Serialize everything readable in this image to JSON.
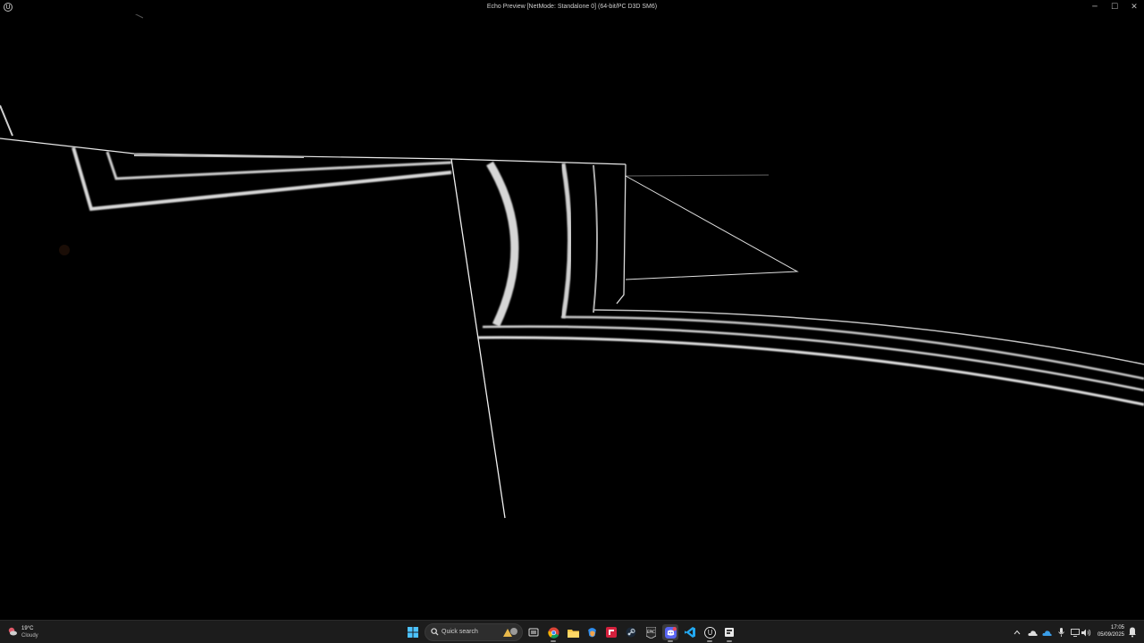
{
  "window": {
    "title": "Echo Preview [NetMode: Standalone 0]  (64-bit/PC D3D SM6)",
    "app_icon": "unreal-engine-icon",
    "controls": {
      "minimize": "─",
      "maximize": "☐",
      "close": "✕"
    }
  },
  "taskbar": {
    "weather": {
      "temperature": "19°C",
      "condition": "Cloudy",
      "icon": "cloudy-weather-icon"
    },
    "search": {
      "label": "Quick search",
      "icon": "search-icon"
    },
    "apps": [
      {
        "name": "start-button",
        "icon": "windows-logo-icon"
      },
      {
        "name": "task-view-button",
        "icon": "task-view-icon"
      },
      {
        "name": "chrome-app",
        "icon": "chrome-icon"
      },
      {
        "name": "file-explorer-app",
        "icon": "folder-icon"
      },
      {
        "name": "copilot-app",
        "icon": "copilot-icon"
      },
      {
        "name": "red-app",
        "icon": "red-app-icon"
      },
      {
        "name": "steam-app",
        "icon": "steam-icon"
      },
      {
        "name": "epic-games-app",
        "icon": "epic-games-icon"
      },
      {
        "name": "discord-app",
        "icon": "discord-icon"
      },
      {
        "name": "vscode-app",
        "icon": "vscode-icon"
      },
      {
        "name": "unreal-engine-app",
        "icon": "unreal-engine-icon"
      },
      {
        "name": "tool-app",
        "icon": "tool-icon"
      }
    ],
    "tray": {
      "chevron": "^",
      "icons": [
        "chevron-up-icon",
        "cloud-icon",
        "onedrive-icon",
        "microphone-icon",
        "display-icon",
        "network-icon",
        "volume-icon"
      ]
    },
    "clock": {
      "time": "17:05",
      "date": "05/09/2025"
    }
  },
  "colors": {
    "background": "#000000",
    "taskbar": "#1c1c1c",
    "line": "#e8e8e8"
  }
}
